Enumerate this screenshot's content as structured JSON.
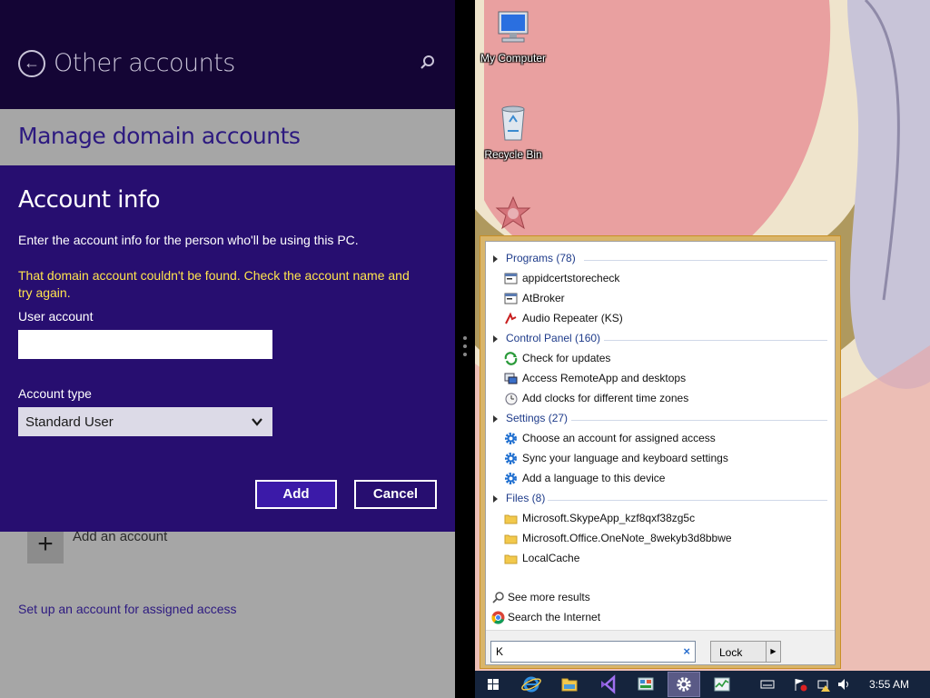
{
  "settings": {
    "title": "Other accounts",
    "section_title": "Manage domain accounts",
    "add_account_label": "Add an account",
    "assigned_access_link": "Set up an account for assigned access"
  },
  "dialog": {
    "title": "Account info",
    "description": "Enter the account info for the person who'll be using this PC.",
    "error": "That domain account couldn't be found. Check the account name and try again.",
    "user_account_label": "User account",
    "user_account_value": "",
    "account_type_label": "Account type",
    "account_type_value": "Standard User",
    "add_label": "Add",
    "cancel_label": "Cancel"
  },
  "desktop": {
    "icons": [
      {
        "label": "My Computer",
        "icon": "computer-icon"
      },
      {
        "label": "Recycle Bin",
        "icon": "recycle-bin-icon"
      },
      {
        "label": "",
        "icon": "app-shortcut-icon"
      }
    ]
  },
  "search": {
    "groups": [
      {
        "label": "Programs (78)",
        "items": [
          {
            "text": "appidcertstorecheck",
            "icon": "console-app-icon"
          },
          {
            "text": "AtBroker",
            "icon": "console-app-icon"
          },
          {
            "text": "Audio Repeater (KS)",
            "icon": "audio-repeater-icon"
          }
        ]
      },
      {
        "label": "Control Panel (160)",
        "items": [
          {
            "text": "Check for updates",
            "icon": "windows-update-icon"
          },
          {
            "text": "Access RemoteApp and desktops",
            "icon": "remote-app-icon"
          },
          {
            "text": "Add clocks for different time zones",
            "icon": "clock-icon"
          }
        ]
      },
      {
        "label": "Settings (27)",
        "items": [
          {
            "text": "Choose an account for assigned access",
            "icon": "settings-gear-icon"
          },
          {
            "text": "Sync your language and keyboard settings",
            "icon": "settings-gear-icon"
          },
          {
            "text": "Add a language to this device",
            "icon": "settings-gear-icon"
          }
        ]
      },
      {
        "label": "Files (8)",
        "items": [
          {
            "text": "Microsoft.SkypeApp_kzf8qxf38zg5c",
            "icon": "folder-icon"
          },
          {
            "text": "Microsoft.Office.OneNote_8wekyb3d8bbwe",
            "icon": "folder-icon"
          },
          {
            "text": "LocalCache",
            "icon": "folder-icon"
          }
        ]
      }
    ],
    "see_more": "See more results",
    "search_internet": "Search the Internet",
    "query": "K",
    "clear_glyph": "×",
    "lock_label": "Lock",
    "lock_arrow_glyph": "▶"
  },
  "taskbar": {
    "clock": "3:55 AM",
    "buttons": [
      "start-button",
      "internet-explorer-button",
      "file-explorer-button",
      "visual-studio-button",
      "control-panel-button",
      "settings-button",
      "task-manager-button"
    ],
    "active_button": "settings-button"
  },
  "colors": {
    "accent": "#270e70",
    "header": "#140535",
    "error_text": "#ffe44d",
    "link": "#2d1a80"
  }
}
